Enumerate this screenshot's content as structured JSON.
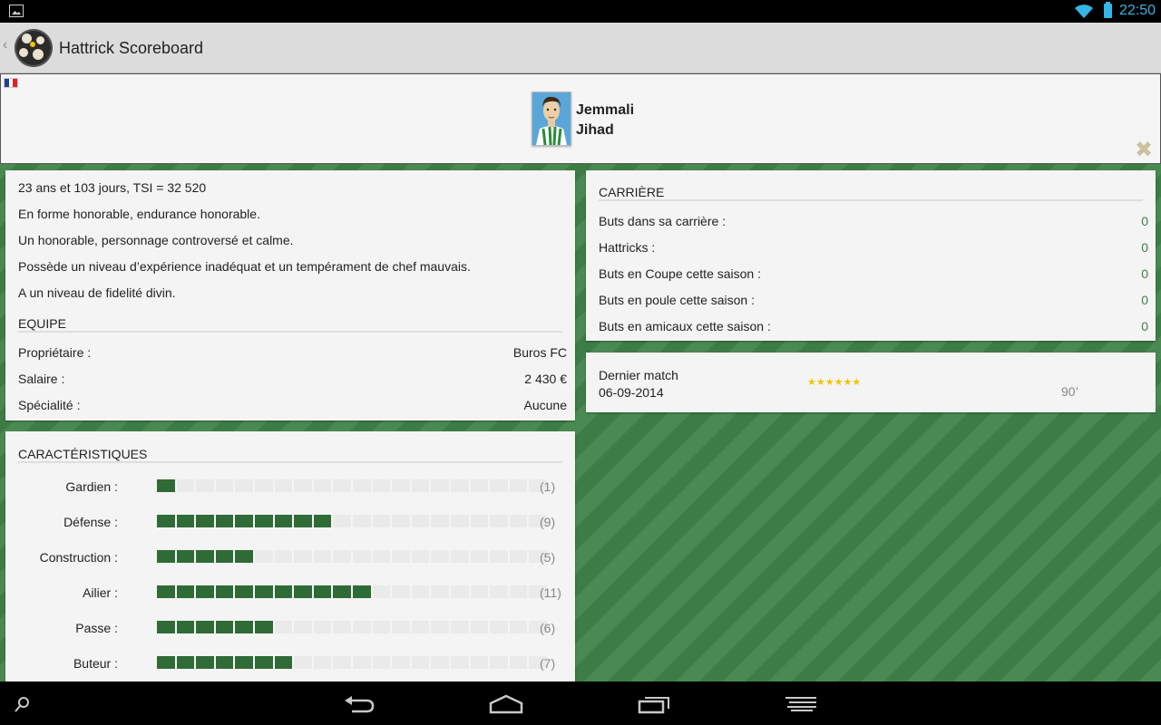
{
  "status_bar": {
    "time": "22:50"
  },
  "app": {
    "title": "Hattrick Scoreboard"
  },
  "player": {
    "last_name": "Jemmali",
    "first_name": "Jihad"
  },
  "info_lines": [
    "23 ans et 103 jours, TSI = 32 520",
    "En forme honorable, endurance honorable.",
    "Un honorable, personnage controversé et calme.",
    "Possède un niveau d’expérience inadéquat et un tempérament de chef mauvais.",
    "A un niveau de fidelité divin."
  ],
  "team": {
    "title": "EQUIPE",
    "rows": [
      {
        "label": "Propriétaire :",
        "value": "Buros FC"
      },
      {
        "label": "Salaire :",
        "value": "2 430 €"
      },
      {
        "label": "Spécialité :",
        "value": "Aucune"
      }
    ]
  },
  "skills": {
    "title": "CARACTÉRISTIQUES",
    "max_level": 20,
    "items": [
      {
        "label": "Gardien :",
        "level": 1,
        "level_text": "(1)"
      },
      {
        "label": "Défense :",
        "level": 9,
        "level_text": "(9)"
      },
      {
        "label": "Construction :",
        "level": 5,
        "level_text": "(5)"
      },
      {
        "label": "Ailier :",
        "level": 11,
        "level_text": "(11)"
      },
      {
        "label": "Passe :",
        "level": 6,
        "level_text": "(6)"
      },
      {
        "label": "Buteur :",
        "level": 7,
        "level_text": "(7)"
      }
    ]
  },
  "career": {
    "title": "CARRIÈRE",
    "rows": [
      {
        "label": "Buts dans sa carrière :",
        "value": "0"
      },
      {
        "label": "Hattricks :",
        "value": "0"
      },
      {
        "label": "Buts en Coupe cette saison :",
        "value": "0"
      },
      {
        "label": "Buts en poule cette saison :",
        "value": "0"
      },
      {
        "label": "Buts en amicaux cette saison :",
        "value": "0"
      }
    ]
  },
  "last_match": {
    "label": "Dernier match",
    "date": "06-09-2014",
    "stars": "★★★★★★",
    "minutes": "90’"
  },
  "colors": {
    "accent_green": "#3f7d47",
    "skill_bar": "#2f6b36",
    "status_blue": "#33b5e5",
    "stars": "#f2c500"
  },
  "icons": {
    "status": [
      "image-icon",
      "wifi-icon",
      "battery-icon"
    ],
    "nav": [
      "search-icon",
      "back-icon",
      "home-icon",
      "recent-apps-icon",
      "menu-icon"
    ]
  }
}
